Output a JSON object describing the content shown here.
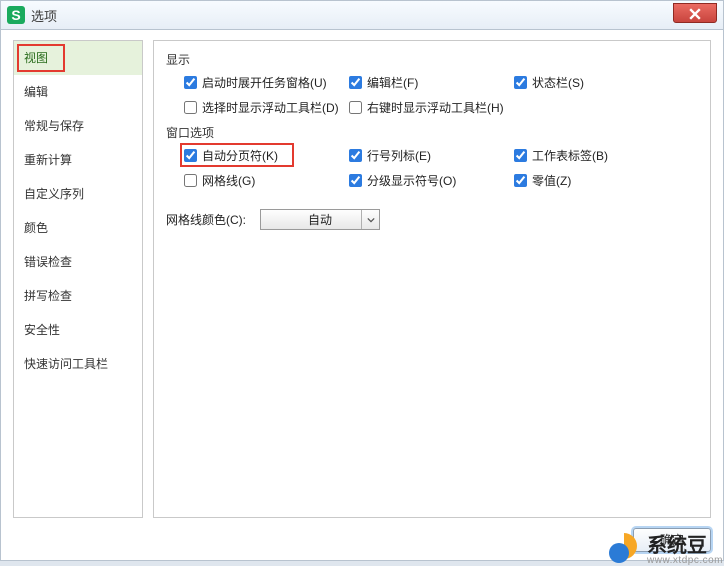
{
  "window": {
    "title": "选项",
    "icon_letter": "S",
    "close_label": "×"
  },
  "sidebar": {
    "items": [
      "视图",
      "编辑",
      "常规与保存",
      "重新计算",
      "自定义序列",
      "颜色",
      "错误检查",
      "拼写检查",
      "安全性",
      "快速访问工具栏"
    ],
    "selected_index": 0
  },
  "sections": {
    "display": {
      "title": "显示",
      "items": [
        {
          "label": "启动时展开任务窗格(U)",
          "checked": true
        },
        {
          "label": "编辑栏(F)",
          "checked": true
        },
        {
          "label": "状态栏(S)",
          "checked": true
        },
        {
          "label": "选择时显示浮动工具栏(D)",
          "checked": false
        },
        {
          "label": "右键时显示浮动工具栏(H)",
          "checked": false
        }
      ]
    },
    "window_options": {
      "title": "窗口选项",
      "items": [
        {
          "label": "自动分页符(K)",
          "checked": true
        },
        {
          "label": "行号列标(E)",
          "checked": true
        },
        {
          "label": "工作表标签(B)",
          "checked": true
        },
        {
          "label": "网格线(G)",
          "checked": false
        },
        {
          "label": "分级显示符号(O)",
          "checked": true
        },
        {
          "label": "零值(Z)",
          "checked": true
        }
      ]
    },
    "gridline_color": {
      "label": "网格线颜色(C):",
      "value": "自动"
    }
  },
  "buttons": {
    "ok": "确定"
  },
  "watermark": {
    "text": "系统豆",
    "sub": "www.xtdpc.com"
  }
}
